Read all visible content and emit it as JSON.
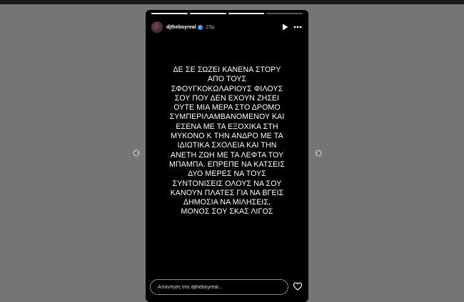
{
  "story": {
    "username": "djtheboyreal",
    "time": "23μ",
    "progress": [
      {
        "fill": 100
      },
      {
        "fill": 100
      },
      {
        "fill": 100
      },
      {
        "fill": 0
      }
    ],
    "text_lines": [
      "ΔΕ ΣΕ ΣΩΖΕΙ ΚΑΝΕΝΑ ΣΤΟΡΥ",
      "ΑΠΟ ΤΟΥΣ",
      "ΣΦΟΥΓΚΟΚΩΛΑΡΙΟΥΣ ΦΙΛΟΥΣ",
      "ΣΟΥ ΠΟΥ ΔΕΝ ΕΧΟΥΝ ΖΗΣΕΙ",
      "ΟΥΤΕ ΜΙΑ ΜΕΡΑ ΣΤΟ ΔΡΟΜΟ",
      "ΣΥΜΠΕΡΙΛΑΜΒΑΝΟΜΕΝΟΥ ΚΑΙ",
      "ΕΣΕΝΑ ΜΕ ΤΑ ΕΞΟΧΙΚΑ ΣΤΗ",
      "ΜΥΚΟΝΟ Κ ΤΗΝ ΑΝΔΡΟ ΜΕ ΤΑ",
      "ΙΔΙΩΤΙΚΑ ΣΧΟΛΕΙΑ ΚΑΙ ΤΗΝ",
      "ΑΝΕΤΗ ΖΩΗ ΜΕ ΤΑ ΛΕΦΤΑ ΤΟΥ",
      "ΜΠΑΜΠΑ. ΕΠΡΕΠΕ ΝΑ ΚΑΤΣΕΙΣ",
      "ΔΥΟ ΜΕΡΕΣ ΝΑ ΤΟΥΣ",
      "ΣΥΝΤΟΝΙΣΕΙΣ ΟΛΟΥΣ ΝΑ ΣΟΥ",
      "ΚΑΝΟΥΝ ΠΛΑΤΕΣ ΓΙΑ ΝΑ ΒΓΕΙΣ",
      "ΔΗΜΟΣΙΑ ΝΑ ΜΙΛΗΣΕΙΣ,",
      "ΜΟΝΟΣ ΣΟΥ ΣΚΑΣ ΛΙΓΟΣ"
    ],
    "reply_placeholder": "Απάντηση στο djtheboyreal...",
    "icons": {
      "avatar": "avatar",
      "verified": "verified-badge-icon",
      "play": "play-icon",
      "more": "more-dots-icon",
      "heart": "heart-icon",
      "prev": "chevron-left-icon",
      "next": "chevron-right-icon"
    },
    "colors": {
      "background": "#757575",
      "story_bg": "#000000",
      "text": "#ffffff",
      "verified": "#3897f0"
    }
  }
}
